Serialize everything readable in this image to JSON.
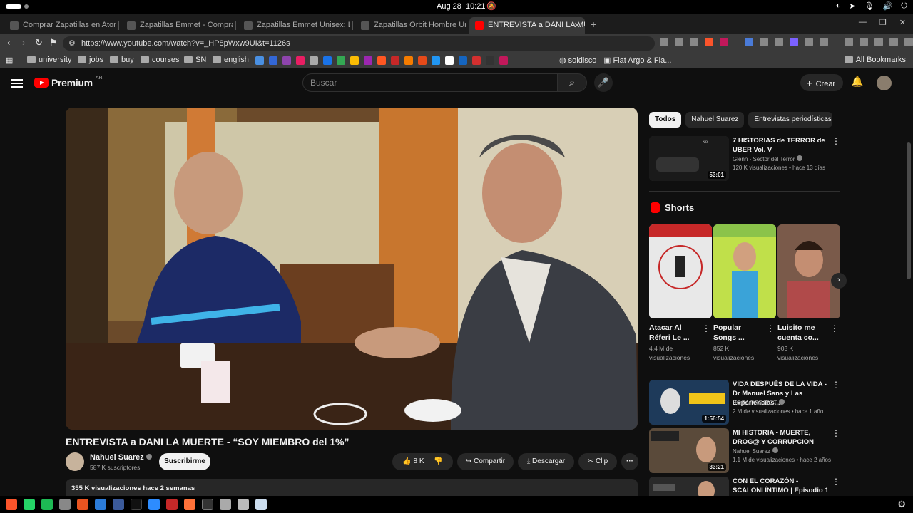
{
  "system": {
    "date": "Aug 28",
    "time": "10:21"
  },
  "browser": {
    "tabs": [
      {
        "label": "Comprar Zapatillas en Atomik"
      },
      {
        "label": "Zapatillas Emmet - Comprar en"
      },
      {
        "label": "Zapatillas Emmet Unisex: Live"
      },
      {
        "label": "Zapatillas Orbit Hombre Urban"
      },
      {
        "label": "ENTREVISTA a DANI LA MUERTE"
      }
    ],
    "url": "https://www.youtube.com/watch?v=_HP8pWxw9UI&t=1126s",
    "bookmarks": [
      {
        "label": "university"
      },
      {
        "label": "jobs"
      },
      {
        "label": "buy"
      },
      {
        "label": "courses"
      },
      {
        "label": "SN"
      },
      {
        "label": "english"
      }
    ],
    "bookmark_extra": [
      {
        "label": "soldisco"
      },
      {
        "label": "Fiat Argo & Fia..."
      }
    ],
    "all_bookmarks": "All Bookmarks"
  },
  "youtube": {
    "logo": "Premium",
    "region": "AR",
    "search_placeholder": "Buscar",
    "create_label": "Crear",
    "video": {
      "title": "ENTREVISTA a DANI LA MUERTE - “SOY MIEMBRO del 1%”",
      "channel": "Nahuel Suarez",
      "subscribers": "587 K suscriptores",
      "subscribe_label": "Suscribirme",
      "likes": "8 K",
      "share_label": "Compartir",
      "download_label": "Descargar",
      "clip_label": "Clip",
      "views_date": "355 K visualizaciones  hace 2 semanas"
    },
    "chips": [
      {
        "label": "Todos"
      },
      {
        "label": "Nahuel Suarez"
      },
      {
        "label": "Entrevistas periodísticas"
      }
    ],
    "recommendations": [
      {
        "title": "7 HISTORIAS de TERROR de UBER Vol. V",
        "channel": "Glenn - Sector del Terror",
        "meta": "120 K visualizaciones • hace 13 días",
        "duration": "53:01"
      },
      {
        "title": "VIDA DESPUÉS DE LA VIDA - Dr Manuel Sans y Las Experiencias...",
        "channel": "ROCA PROJECT",
        "meta": "2 M de visualizaciones • hace 1 año",
        "duration": "1:56:54"
      },
      {
        "title": "MI HISTORIA - MUERTE, DROG@ Y CORRUPCION",
        "channel": "Nahuel Suarez",
        "meta": "1,1 M de visualizaciones • hace 2 años",
        "duration": "33:21"
      },
      {
        "title": "CON EL CORAZÓN - SCALONI ÍNTIMO | Episodio 1",
        "channel": "",
        "meta": "",
        "duration": ""
      }
    ],
    "shorts_title": "Shorts",
    "shorts": [
      {
        "title": "Atacar Al Réferi Le ...",
        "views": "4,4 M de visualizaciones"
      },
      {
        "title": "Popular Songs ...",
        "views": "852 K visualizaciones"
      },
      {
        "title": "Luisito me cuenta co...",
        "views": "903 K visualizaciones"
      }
    ]
  },
  "colors": {
    "background": "#0f0f0f",
    "brand_red": "#ff0000",
    "chip_bg": "#272727"
  }
}
